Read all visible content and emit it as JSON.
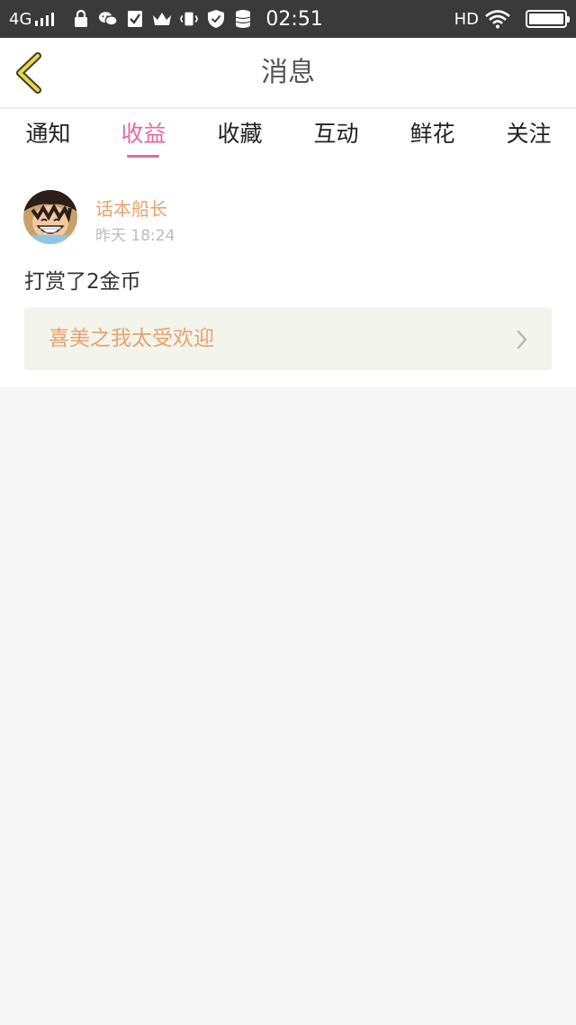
{
  "status_bar": {
    "network": "4G",
    "time": "02:51",
    "hd": "HD",
    "icons": [
      "signal-icon",
      "lock-icon",
      "wechat-icon",
      "check-icon",
      "crown-icon",
      "vibrate-icon",
      "shield-icon",
      "database-icon",
      "wifi-icon",
      "battery-icon"
    ]
  },
  "nav": {
    "title": "消息",
    "back_icon": "chevron-left-icon"
  },
  "tabs": [
    {
      "label": "通知",
      "active": false
    },
    {
      "label": "收益",
      "active": true
    },
    {
      "label": "收藏",
      "active": false
    },
    {
      "label": "互动",
      "active": false
    },
    {
      "label": "鲜花",
      "active": false
    },
    {
      "label": "关注",
      "active": false
    }
  ],
  "message": {
    "username": "话本船长",
    "timestamp": "昨天 18:24",
    "text": "打赏了2金币",
    "link_text": "喜美之我太受欢迎",
    "link_icon": "chevron-right-icon"
  },
  "colors": {
    "accent": "#e36aa0",
    "orange": "#e9a26b",
    "back_arrow": "#e8d84a"
  }
}
